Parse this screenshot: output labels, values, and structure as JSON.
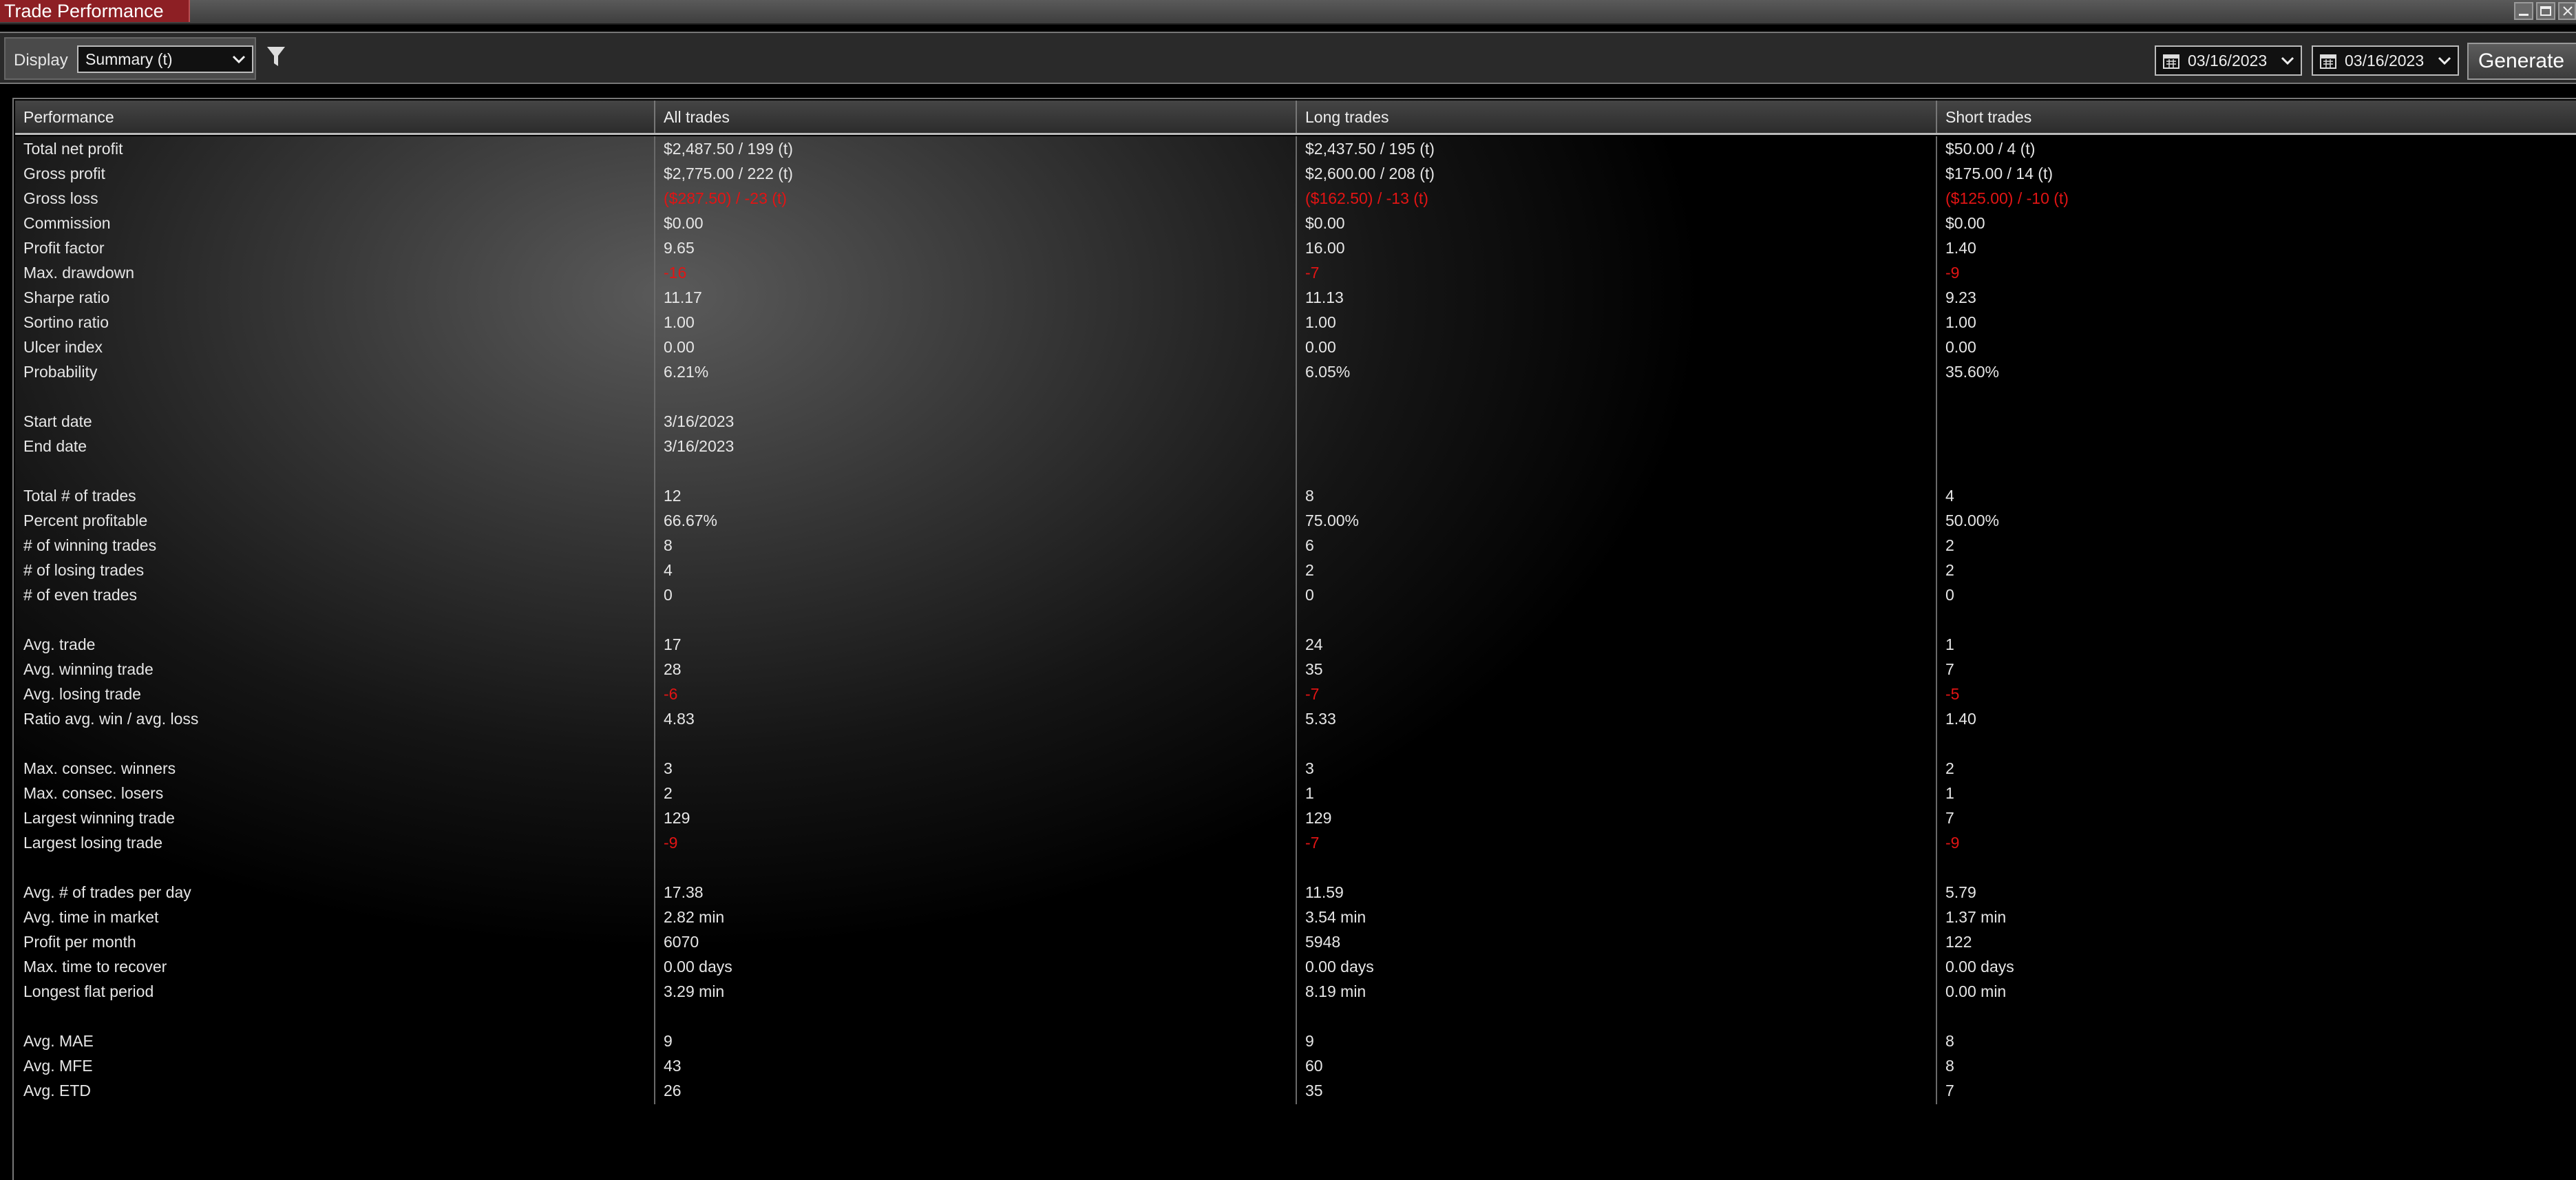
{
  "window": {
    "title": "Trade Performance"
  },
  "toolbar": {
    "display_label": "Display",
    "display_value": "Summary (t)",
    "from_date": "03/16/2023",
    "to_date": "03/16/2023",
    "generate_label": "Generate"
  },
  "colors": {
    "negative": "#e21414",
    "title_tab": "#8d1f24"
  },
  "grid": {
    "headers": [
      "Performance",
      "All trades",
      "Long trades",
      "Short trades"
    ],
    "rows": [
      {
        "label": "Total net profit",
        "all": "$2,487.50 / 199 (t)",
        "long": "$2,437.50 / 195 (t)",
        "short": "$50.00 / 4 (t)",
        "neg": [
          false,
          false,
          false
        ]
      },
      {
        "label": "Gross profit",
        "all": "$2,775.00 / 222 (t)",
        "long": "$2,600.00 / 208 (t)",
        "short": "$175.00 / 14 (t)",
        "neg": [
          false,
          false,
          false
        ]
      },
      {
        "label": "Gross loss",
        "all": "($287.50) / -23 (t)",
        "long": "($162.50) / -13 (t)",
        "short": "($125.00) / -10 (t)",
        "neg": [
          true,
          true,
          true
        ]
      },
      {
        "label": "Commission",
        "all": "$0.00",
        "long": "$0.00",
        "short": "$0.00",
        "neg": [
          false,
          false,
          false
        ]
      },
      {
        "label": "Profit factor",
        "all": "9.65",
        "long": "16.00",
        "short": "1.40",
        "neg": [
          false,
          false,
          false
        ]
      },
      {
        "label": "Max. drawdown",
        "all": "-16",
        "long": "-7",
        "short": "-9",
        "neg": [
          true,
          true,
          true
        ]
      },
      {
        "label": "Sharpe ratio",
        "all": "11.17",
        "long": "11.13",
        "short": "9.23",
        "neg": [
          false,
          false,
          false
        ]
      },
      {
        "label": "Sortino ratio",
        "all": "1.00",
        "long": "1.00",
        "short": "1.00",
        "neg": [
          false,
          false,
          false
        ]
      },
      {
        "label": "Ulcer index",
        "all": "0.00",
        "long": "0.00",
        "short": "0.00",
        "neg": [
          false,
          false,
          false
        ]
      },
      {
        "label": "Probability",
        "all": "6.21%",
        "long": "6.05%",
        "short": "35.60%",
        "neg": [
          false,
          false,
          false
        ]
      },
      {
        "label": "",
        "all": "",
        "long": "",
        "short": "",
        "neg": [
          false,
          false,
          false
        ]
      },
      {
        "label": "Start date",
        "all": "3/16/2023",
        "long": "",
        "short": "",
        "neg": [
          false,
          false,
          false
        ]
      },
      {
        "label": "End date",
        "all": "3/16/2023",
        "long": "",
        "short": "",
        "neg": [
          false,
          false,
          false
        ]
      },
      {
        "label": "",
        "all": "",
        "long": "",
        "short": "",
        "neg": [
          false,
          false,
          false
        ]
      },
      {
        "label": "Total # of trades",
        "all": "12",
        "long": "8",
        "short": "4",
        "neg": [
          false,
          false,
          false
        ]
      },
      {
        "label": "Percent profitable",
        "all": "66.67%",
        "long": "75.00%",
        "short": "50.00%",
        "neg": [
          false,
          false,
          false
        ]
      },
      {
        "label": "# of winning trades",
        "all": "8",
        "long": "6",
        "short": "2",
        "neg": [
          false,
          false,
          false
        ]
      },
      {
        "label": "# of losing trades",
        "all": "4",
        "long": "2",
        "short": "2",
        "neg": [
          false,
          false,
          false
        ]
      },
      {
        "label": "# of even trades",
        "all": "0",
        "long": "0",
        "short": "0",
        "neg": [
          false,
          false,
          false
        ]
      },
      {
        "label": "",
        "all": "",
        "long": "",
        "short": "",
        "neg": [
          false,
          false,
          false
        ]
      },
      {
        "label": "Avg. trade",
        "all": "17",
        "long": "24",
        "short": "1",
        "neg": [
          false,
          false,
          false
        ]
      },
      {
        "label": "Avg. winning trade",
        "all": "28",
        "long": "35",
        "short": "7",
        "neg": [
          false,
          false,
          false
        ]
      },
      {
        "label": "Avg. losing trade",
        "all": "-6",
        "long": "-7",
        "short": "-5",
        "neg": [
          true,
          true,
          true
        ]
      },
      {
        "label": "Ratio avg. win / avg. loss",
        "all": "4.83",
        "long": "5.33",
        "short": "1.40",
        "neg": [
          false,
          false,
          false
        ]
      },
      {
        "label": "",
        "all": "",
        "long": "",
        "short": "",
        "neg": [
          false,
          false,
          false
        ]
      },
      {
        "label": "Max. consec. winners",
        "all": "3",
        "long": "3",
        "short": "2",
        "neg": [
          false,
          false,
          false
        ]
      },
      {
        "label": "Max. consec. losers",
        "all": "2",
        "long": "1",
        "short": "1",
        "neg": [
          false,
          false,
          false
        ]
      },
      {
        "label": "Largest winning trade",
        "all": "129",
        "long": "129",
        "short": "7",
        "neg": [
          false,
          false,
          false
        ]
      },
      {
        "label": "Largest losing trade",
        "all": "-9",
        "long": "-7",
        "short": "-9",
        "neg": [
          true,
          true,
          true
        ]
      },
      {
        "label": "",
        "all": "",
        "long": "",
        "short": "",
        "neg": [
          false,
          false,
          false
        ]
      },
      {
        "label": "Avg. # of trades per day",
        "all": "17.38",
        "long": "11.59",
        "short": "5.79",
        "neg": [
          false,
          false,
          false
        ]
      },
      {
        "label": "Avg. time in market",
        "all": "2.82 min",
        "long": "3.54 min",
        "short": "1.37 min",
        "neg": [
          false,
          false,
          false
        ]
      },
      {
        "label": "Profit per month",
        "all": "6070",
        "long": "5948",
        "short": "122",
        "neg": [
          false,
          false,
          false
        ]
      },
      {
        "label": "Max. time to recover",
        "all": "0.00 days",
        "long": "0.00 days",
        "short": "0.00 days",
        "neg": [
          false,
          false,
          false
        ]
      },
      {
        "label": "Longest flat period",
        "all": "3.29 min",
        "long": "8.19 min",
        "short": "0.00 min",
        "neg": [
          false,
          false,
          false
        ]
      },
      {
        "label": "",
        "all": "",
        "long": "",
        "short": "",
        "neg": [
          false,
          false,
          false
        ]
      },
      {
        "label": "Avg. MAE",
        "all": "9",
        "long": "9",
        "short": "8",
        "neg": [
          false,
          false,
          false
        ]
      },
      {
        "label": "Avg. MFE",
        "all": "43",
        "long": "60",
        "short": "8",
        "neg": [
          false,
          false,
          false
        ]
      },
      {
        "label": "Avg. ETD",
        "all": "26",
        "long": "35",
        "short": "7",
        "neg": [
          false,
          false,
          false
        ]
      }
    ]
  }
}
